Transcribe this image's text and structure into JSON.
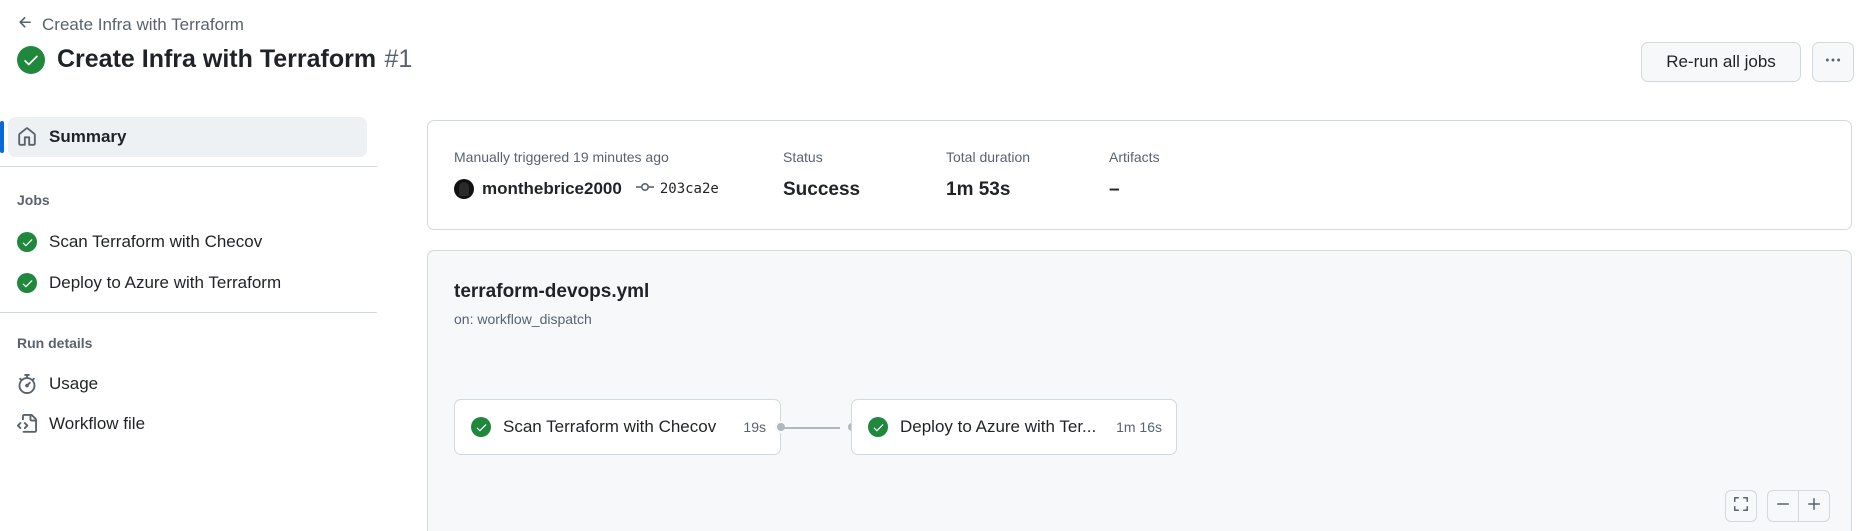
{
  "breadcrumb": {
    "back_label": "Create Infra with Terraform"
  },
  "header": {
    "title": "Create Infra with Terraform",
    "run_number": "#1"
  },
  "actions": {
    "rerun_label": "Re-run all jobs",
    "more_icon": "kebab-horizontal-icon"
  },
  "sidebar": {
    "summary_label": "Summary",
    "jobs_heading": "Jobs",
    "jobs": [
      {
        "label": "Scan Terraform with Checov",
        "status": "success"
      },
      {
        "label": "Deploy to Azure with Terraform",
        "status": "success"
      }
    ],
    "run_details_heading": "Run details",
    "usage_label": "Usage",
    "workflow_file_label": "Workflow file"
  },
  "summary": {
    "trigger_text": "Manually triggered 19 minutes ago",
    "actor": "monthebrice2000",
    "commit": "203ca2e",
    "status_label": "Status",
    "status_value": "Success",
    "duration_label": "Total duration",
    "duration_value": "1m 53s",
    "artifacts_label": "Artifacts",
    "artifacts_value": "–"
  },
  "workflow": {
    "file": "terraform-devops.yml",
    "trigger": "on: workflow_dispatch",
    "jobs": [
      {
        "name": "Scan Terraform with Checov",
        "duration": "19s"
      },
      {
        "name": "Deploy to Azure with Ter...",
        "duration": "1m 16s"
      }
    ]
  },
  "colors": {
    "success": "#1f883d",
    "accent": "#0969da",
    "border": "#d1d9e0",
    "muted": "#59636e"
  }
}
